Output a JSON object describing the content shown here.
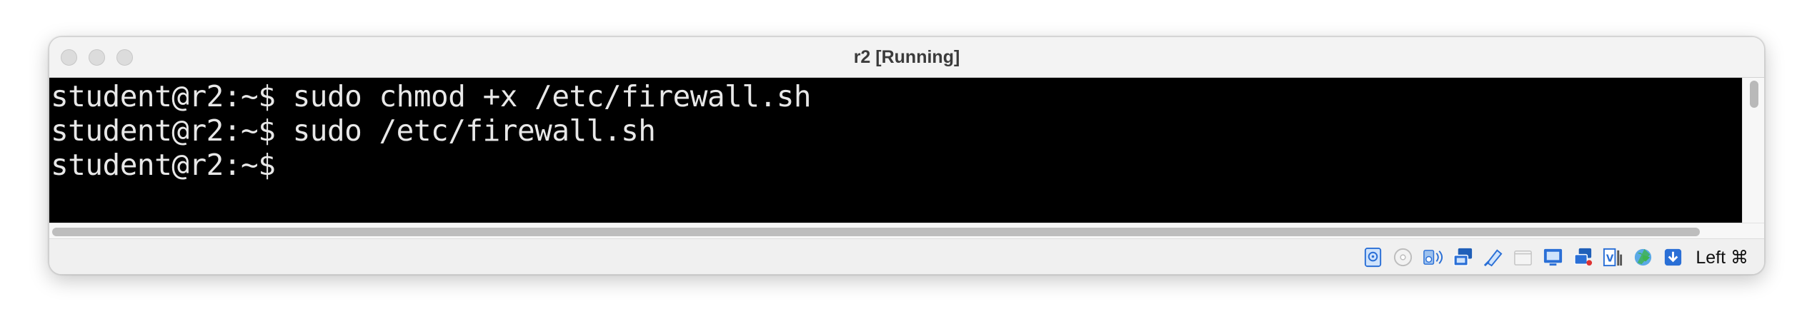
{
  "window": {
    "title": "r2 [Running]"
  },
  "terminal": {
    "lines": [
      "student@r2:~$ sudo chmod +x /etc/firewall.sh",
      "student@r2:~$ sudo /etc/firewall.sh",
      "student@r2:~$"
    ]
  },
  "statusbar": {
    "icons": [
      "hard-disk-icon",
      "optical-drive-icon",
      "audio-icon",
      "network-icon",
      "usb-icon",
      "shared-folders-icon",
      "display-icon",
      "recording-icon",
      "cpu-icon",
      "guest-additions-icon",
      "download-icon"
    ],
    "host_key": "Left ⌘"
  },
  "colors": {
    "terminal_bg": "#000000",
    "terminal_fg": "#e8e8e8",
    "accent_blue": "#2a6fd6"
  }
}
